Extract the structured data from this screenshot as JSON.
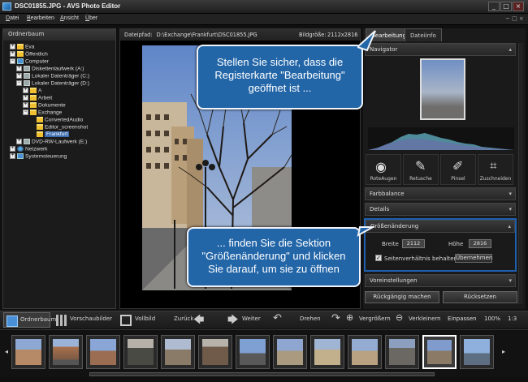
{
  "window": {
    "title": "DSC01855.JPG - AVS Photo Editor",
    "minimize": "_",
    "maximize": "□",
    "close": "×"
  },
  "menu": [
    {
      "hot": "D",
      "rest": "atei"
    },
    {
      "hot": "B",
      "rest": "earbeiten"
    },
    {
      "hot": "A",
      "rest": "nsicht"
    },
    {
      "hot": "Ü",
      "rest": "ber"
    }
  ],
  "tree": {
    "header": "Ordnerbaum",
    "nodes": [
      {
        "label": "Eva",
        "icon": "folder-icon",
        "expander": "+"
      },
      {
        "label": "Öffentlich",
        "icon": "folder-icon",
        "expander": "+"
      },
      {
        "label": "Computer",
        "icon": "computer-icon",
        "expander": "−"
      },
      {
        "label": "Diskettenlaufwerk (A:)",
        "icon": "floppy-icon",
        "expander": "+"
      },
      {
        "label": "Lokaler Datenträger (C:)",
        "icon": "drive-icon",
        "expander": "+"
      },
      {
        "label": "Lokaler Datenträger (D:)",
        "icon": "drive-icon",
        "expander": "−"
      },
      {
        "label": "A",
        "icon": "folder-icon",
        "expander": "+"
      },
      {
        "label": "Arbeit",
        "icon": "folder-icon",
        "expander": "+"
      },
      {
        "label": "Dokumente",
        "icon": "folder-icon",
        "expander": "+"
      },
      {
        "label": "Exchange",
        "icon": "folder-icon",
        "expander": "−"
      },
      {
        "label": "ConvertedAudio",
        "icon": "folder-icon",
        "expander": ""
      },
      {
        "label": "Editor_screenshot",
        "icon": "folder-icon",
        "expander": ""
      },
      {
        "label": "Frankfurt",
        "icon": "folder-icon",
        "expander": ""
      },
      {
        "label": "DVD-RW-Laufwerk (E:)",
        "icon": "dvd-icon",
        "expander": "+"
      },
      {
        "label": "Netzwerk",
        "icon": "network-icon",
        "expander": "+"
      },
      {
        "label": "Systemsteuerung",
        "icon": "control-panel-icon",
        "expander": "+"
      }
    ]
  },
  "center": {
    "path_label": "Dateipfad:",
    "path_value": "D:\\Exchange\\Frankfurt\\DSC01855.JPG",
    "size_label": "Bildgröße:",
    "size_value": "2112x2816"
  },
  "right": {
    "tabs": [
      "Bearbeitung",
      "Dateiinfo"
    ],
    "navigator": "Navigator",
    "tools": [
      "RoteAugen",
      "Retusche",
      "Pinsel",
      "Zuschneiden"
    ],
    "sections": {
      "farbbalance": "Farbbalance",
      "details": "Details",
      "groesse": "Größenänderung",
      "voreinstellungen": "Voreinstellungen"
    },
    "resize": {
      "width_label": "Breite",
      "width_value": "2112",
      "height_label": "Höhe",
      "height_value": "2816",
      "keep_ratio": "Seitenverhältnis behalten",
      "apply": "Übernehmen",
      "keep_ratio_checked": true
    },
    "undo": "Rückgängig machen",
    "reset": "Rücksetzen"
  },
  "toolbar": {
    "tree": "Ordnerbaum",
    "preview": "Vorschaubilder",
    "fullscreen": "Vollbild",
    "back": "Zurück",
    "forward": "Weiter",
    "rotate": "Drehen",
    "zoom_in": "Vergrößern",
    "zoom_out": "Verkleinern",
    "fit": "Einpassen",
    "zoom": "100%",
    "ratio": "1:3"
  },
  "callouts": {
    "first": "Stellen Sie sicher, dass die Registerkarte \"Bearbeitung\" geöffnet ist ...",
    "second": "... finden Sie die Sektion \"Größenänderung\" und klicken Sie darauf, um sie zu öffnen"
  },
  "colors": {
    "accent": "#2366a8",
    "highlight": "#1e5fae",
    "panel": "#1a1a1a"
  }
}
